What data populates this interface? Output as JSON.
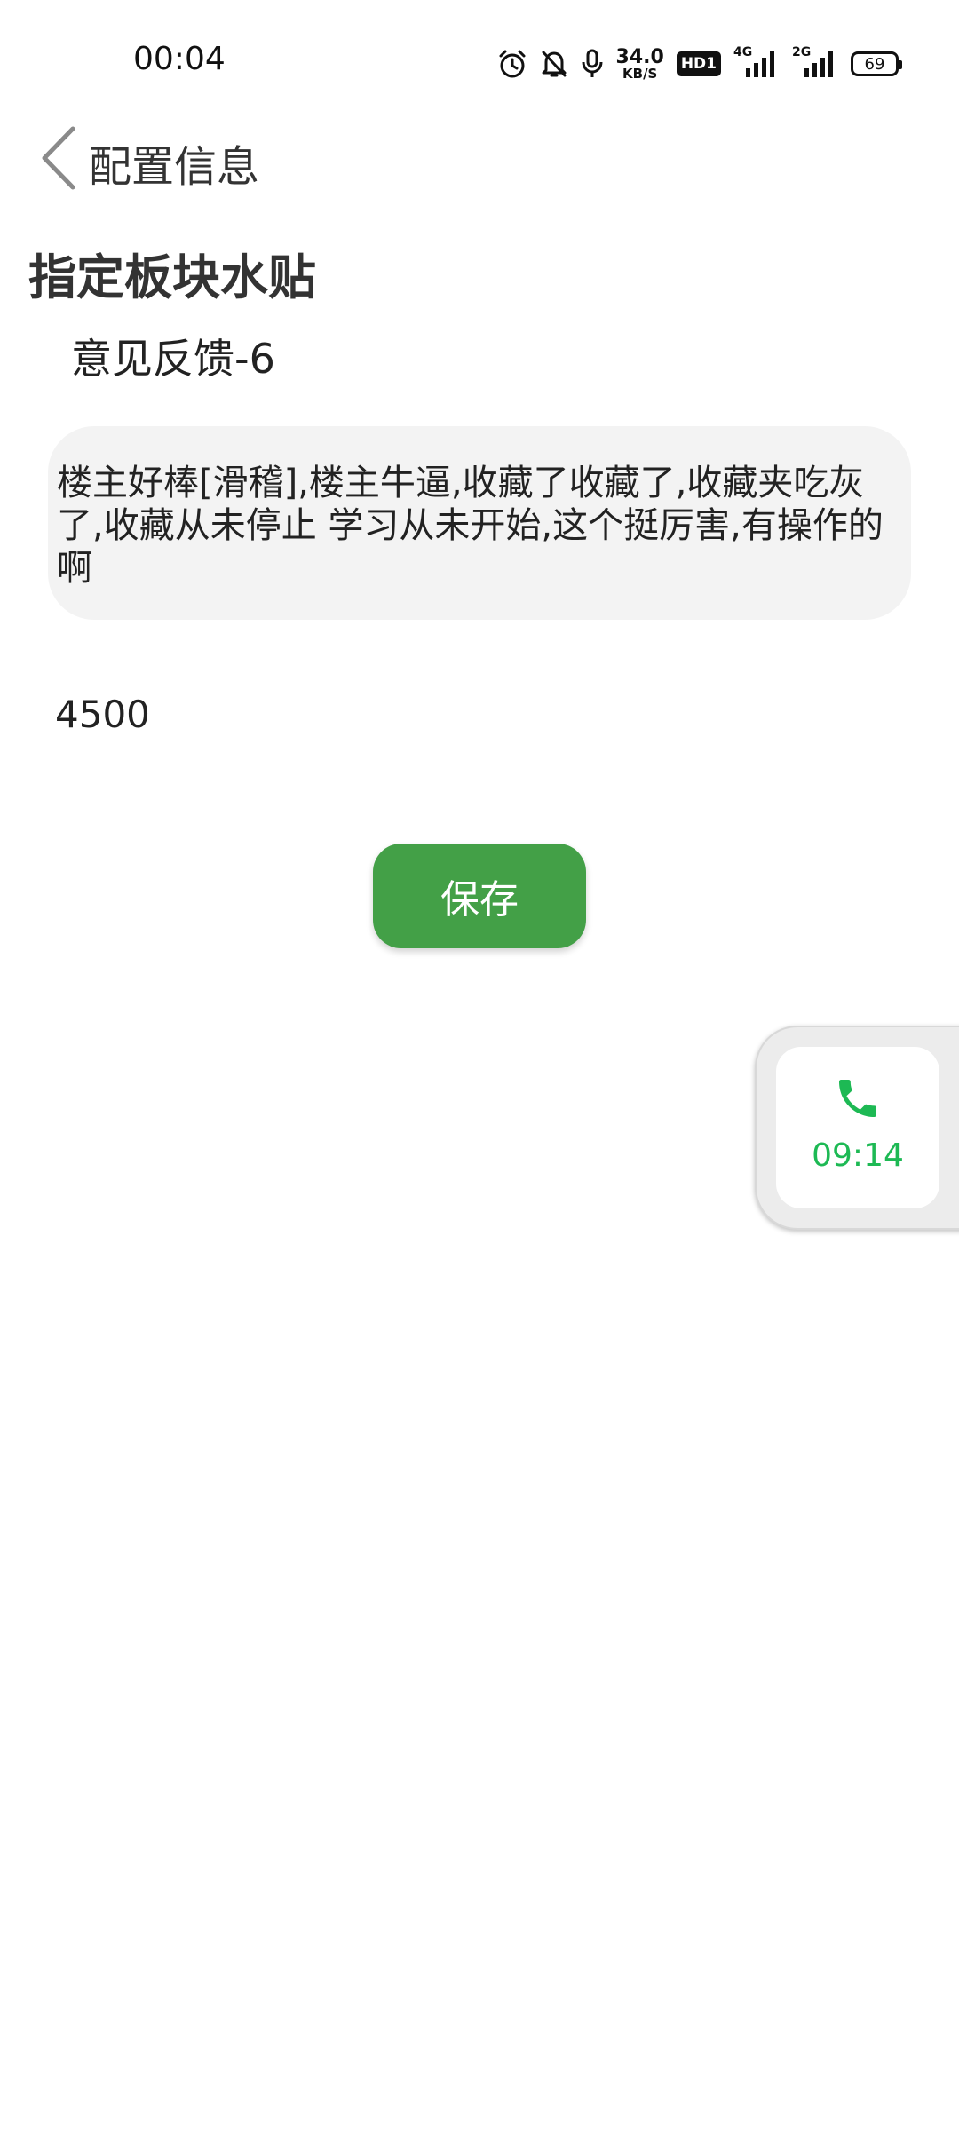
{
  "status_bar": {
    "time": "00:04",
    "net_speed_value": "34.0",
    "net_speed_unit": "KB/S",
    "hd_label": "HD1",
    "signal_1_label": "4G",
    "signal_2_label": "2G",
    "battery_level": "69",
    "icons": [
      "alarm-icon",
      "mute-bell-icon",
      "microphone-icon",
      "signal-4g-icon",
      "signal-2g-icon",
      "battery-icon"
    ]
  },
  "header": {
    "title": "配置信息",
    "back_icon": "chevron-left-icon"
  },
  "main": {
    "section_title": "指定板块水贴",
    "board_name": "意见反馈-6",
    "content_text": "楼主好棒[滑稽],楼主牛逼,收藏了收藏了,收藏夹吃灰了,收藏从未停止 学习从未开始,这个挺厉害,有操作的啊",
    "interval_value": "4500",
    "save_label": "保存"
  },
  "call_float": {
    "duration": "09:14",
    "icon": "phone-icon"
  },
  "colors": {
    "accent_green": "#43a047",
    "call_green": "#1db954",
    "input_bg": "#f3f3f3"
  }
}
